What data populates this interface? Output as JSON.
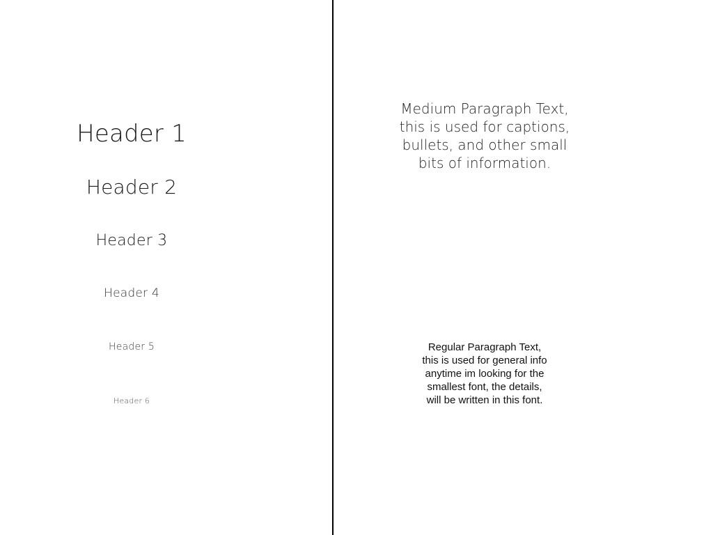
{
  "headers": {
    "h1": "Header 1",
    "h2": "Header 2",
    "h3": "Header 3",
    "h4": "Header 4",
    "h5": "Header 5",
    "h6": "Header 6"
  },
  "medium_paragraph": {
    "lines": [
      "Medium Paragraph Text,",
      "this is used for captions,",
      "bullets, and other small",
      "bits of information."
    ]
  },
  "regular_paragraph": {
    "lines": [
      "Regular Paragraph Text,",
      "this is used for general info",
      "anytime im looking for the",
      "smallest font, the details,",
      "will be written in this font."
    ]
  }
}
